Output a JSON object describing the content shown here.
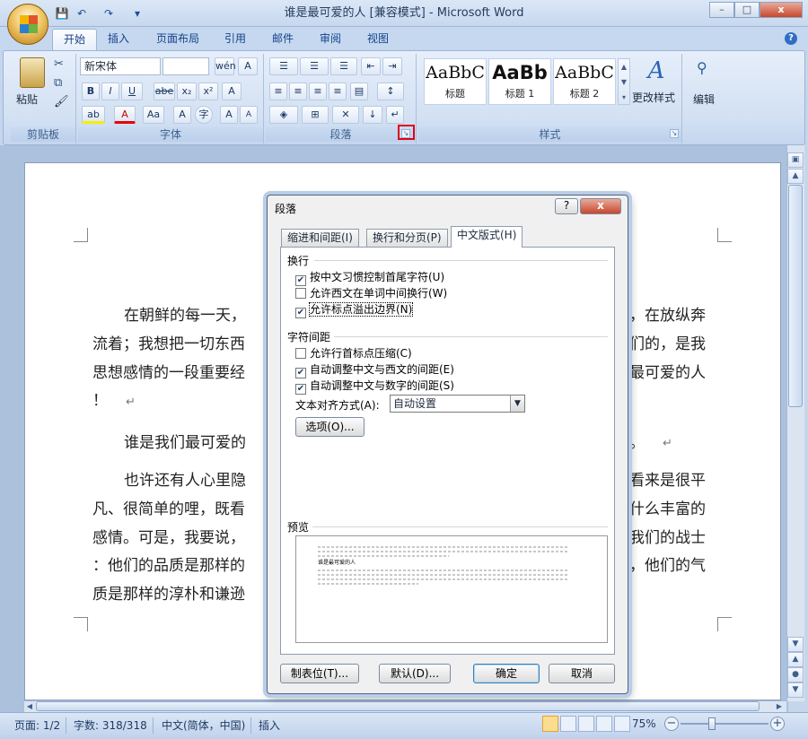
{
  "window": {
    "title": "谁是最可爱的人 [兼容模式] - Microsoft Word",
    "controls": {
      "minimize": "–",
      "maximize": "□",
      "close": "x"
    },
    "help": "?"
  },
  "qat": {
    "save": "💾",
    "undo": "↶",
    "redo": "↷",
    "more": "▾"
  },
  "tabs": [
    {
      "label": "开始"
    },
    {
      "label": "插入"
    },
    {
      "label": "页面布局"
    },
    {
      "label": "引用"
    },
    {
      "label": "邮件"
    },
    {
      "label": "审阅"
    },
    {
      "label": "视图"
    }
  ],
  "ribbon": {
    "clipboard": {
      "label": "剪贴板",
      "paste": "粘贴",
      "cut": "✂",
      "copy": "⧉",
      "format_painter": "🖌"
    },
    "font": {
      "label": "字体",
      "font_name": "新宋体",
      "font_size": "",
      "grow": "wén",
      "change_case": "A",
      "bold": "B",
      "italic": "I",
      "underline": "U",
      "strike": "abe",
      "subscript": "x₂",
      "superscript": "x²",
      "clear": "A",
      "highlight": "ab",
      "font_color": "A",
      "aa": "Aa",
      "char_border": "A",
      "enclosed": "字",
      "grow_font": "A",
      "shrink_font": "A"
    },
    "paragraph": {
      "label": "段落"
    },
    "styles": {
      "label": "样式",
      "tiles": [
        {
          "sample": "AaBbC",
          "name": "标题"
        },
        {
          "sample": "AaBb",
          "name": "标题 1"
        },
        {
          "sample": "AaBbC",
          "name": "标题 2"
        }
      ],
      "change_styles": "更改样式"
    },
    "editing": {
      "label": "编辑"
    }
  },
  "document": {
    "lines": [
      {
        "left": "在朝鲜的每一天，",
        "right": "，在放纵奔"
      },
      {
        "left": "流着；我想把一切东西",
        "right": "们的，是我"
      },
      {
        "left": "思想感情的一段重要经",
        "right": "最可爱的人"
      },
      {
        "left": "！",
        "right": ""
      },
      {
        "left": "谁是我们最可爱的",
        "right": "。"
      },
      {
        "left": "也许还有人心里隐",
        "right": "看来是很平"
      },
      {
        "left": "凡、很简单的哩，既看",
        "right": "什么丰富的"
      },
      {
        "left": "感情。可是，我要说，",
        "right": "我们的战士"
      },
      {
        "left": "：他们的品质是那样的",
        "right": "，他们的气"
      },
      {
        "left": "质是那样的淳朴和谦逊",
        "right": ""
      }
    ],
    "para_mark": "↵"
  },
  "status": {
    "page": "页面: 1/2",
    "words": "字数: 318/318",
    "language": "中文(简体，中国)",
    "mode": "插入",
    "zoom": "75%",
    "zoom_level": 0.75
  },
  "dialog": {
    "title": "段落",
    "tabs": [
      {
        "label": "缩进和间距(I)"
      },
      {
        "label": "换行和分页(P)"
      },
      {
        "label": "中文版式(H)"
      }
    ],
    "line_break": {
      "label": "换行",
      "options": [
        {
          "label": "按中文习惯控制首尾字符(U)",
          "checked": true
        },
        {
          "label": "允许西文在单词中间换行(W)",
          "checked": false
        },
        {
          "label": "允许标点溢出边界(N)",
          "checked": true
        }
      ]
    },
    "char_spacing": {
      "label": "字符间距",
      "options": [
        {
          "label": "允许行首标点压缩(C)",
          "checked": false
        },
        {
          "label": "自动调整中文与西文的间距(E)",
          "checked": true
        },
        {
          "label": "自动调整中文与数字的间距(S)",
          "checked": true
        }
      ]
    },
    "align": {
      "label": "文本对齐方式(A):",
      "value": "自动设置"
    },
    "options_button": "选项(O)...",
    "preview": {
      "label": "预览",
      "sample": "谁是最可爱的人"
    },
    "buttons": {
      "tabs": "制表位(T)...",
      "default": "默认(D)...",
      "ok": "确定",
      "cancel": "取消"
    },
    "help": "?",
    "close": "x"
  }
}
